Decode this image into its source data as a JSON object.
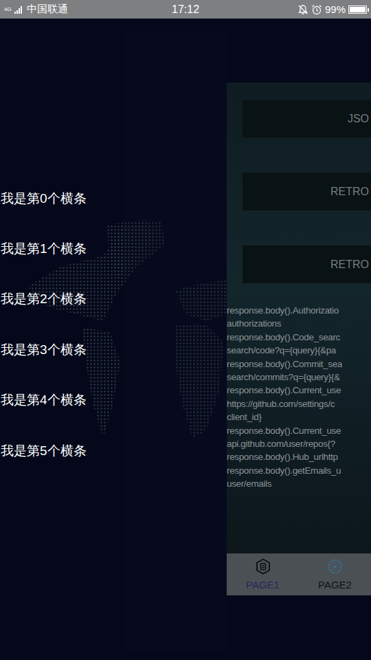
{
  "status_bar": {
    "network": "4G",
    "carrier": "中国联通",
    "time": "17:12",
    "battery": "99%",
    "battery_level": 0.99
  },
  "drawer": {
    "items": [
      "我是第0个横条",
      "我是第1个横条",
      "我是第2个横条",
      "我是第3个横条",
      "我是第4个横条",
      "我是第5个横条"
    ]
  },
  "main": {
    "buttons": [
      "JSO",
      "RETRO",
      "RETRO"
    ],
    "log_lines": [
      "response.body().Authorizatio",
      "authorizations",
      "response.body().Code_searc",
      "search/code?q={query}{&pa",
      "response.body().Commit_sea",
      "search/commits?q={query}{&",
      "response.body().Current_use",
      "https://github.com/settings/c",
      "client_id}",
      "response.body().Current_use",
      "api.github.com/user/repos{?",
      "response.body().Hub_urlhttp",
      "response.body().getEmails_u",
      "user/emails"
    ]
  },
  "bottom_nav": {
    "tabs": [
      {
        "label": "PAGE1",
        "selected": true
      },
      {
        "label": "PAGE2",
        "selected": false
      }
    ]
  }
}
